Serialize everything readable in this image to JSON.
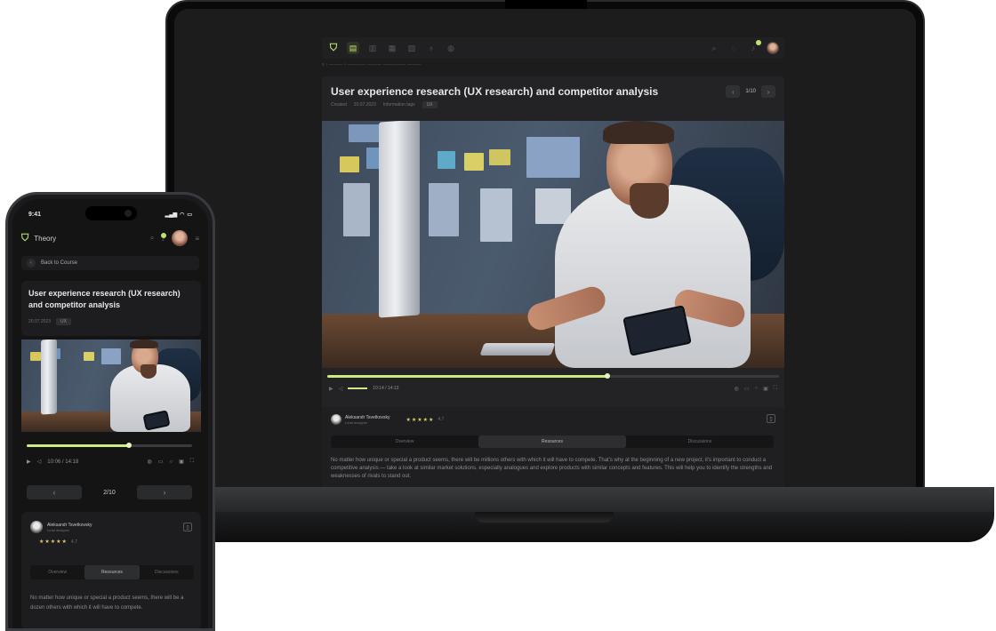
{
  "laptop": {
    "breadcrumb": "≡ › ——— › ———— ——— ————— ———",
    "lesson": {
      "title": "User experience research (UX research) and competitor analysis",
      "date_label": "Created",
      "date": "20.07.2023",
      "category_label": "Information tags",
      "tag": "UX"
    },
    "pager": {
      "current": "1/10",
      "prev_icon": "chevron-left",
      "next_icon": "chevron-right"
    },
    "video": {
      "time": "10:14 / 14:13",
      "progress": 0.62
    },
    "teacher": {
      "name": "Aleksandr Tsvetkovsky",
      "subtitle": "Lead designer",
      "stars": "★★★★★",
      "rating": "4.7"
    },
    "tabs": [
      "Overview",
      "Resources",
      "Discussions"
    ],
    "active_tab": 1,
    "body": "No matter how unique or special a product seems, there will be millions others with which it will have to compete. That's why at the beginning of a new project, it's important to conduct a competitive analysis — take a look at similar market solutions, especially analogues and explore products with similar concepts and features. This will help you to identify the strengths and weaknesses of rivals to stand out."
  },
  "phone": {
    "status": {
      "time": "9:41",
      "signal": "▂▄▆",
      "wifi": "◠",
      "battery": "▭"
    },
    "brand": "Theory",
    "back_label": "Back to Course",
    "lesson": {
      "title": "User experience research (UX research) and competitor analysis",
      "date": "20.07.2023",
      "tag": "UX"
    },
    "video": {
      "time": "10:06 / 14:18",
      "progress": 0.62
    },
    "pager": {
      "current": "2/10"
    },
    "teacher": {
      "name": "Aleksandr Tsvetkovsky",
      "subtitle": "Lead designer",
      "stars": "★★★★★",
      "rating": "4.7"
    },
    "tabs": [
      "Overview",
      "Resources",
      "Discussions"
    ],
    "active_tab": 1,
    "body": "No matter how unique or special a product seems, there will be a dozen others with which it will have to compete."
  },
  "colors": {
    "accent": "#cdea83",
    "bg": "#1c1c1d",
    "star": "#e3c866"
  }
}
